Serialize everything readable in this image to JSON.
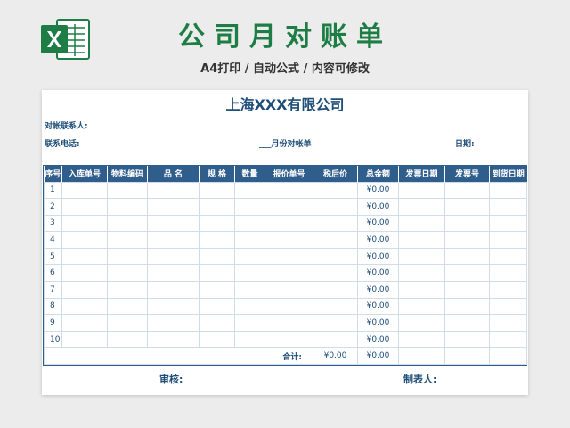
{
  "header": {
    "title": "公司月对账单",
    "subtitle": "A4打印 / 自动公式 / 内容可修改",
    "logo_icon": "excel-logo-icon",
    "accent_color": "#1e7d45"
  },
  "sheet": {
    "company": "上海XXX有限公司",
    "contact_label": "对帐联系人:",
    "phone_label": "联系电话:",
    "month_label": "___月份对帐单",
    "date_label": "日期:",
    "header_color": "#2f5d8c",
    "columns": [
      "序号",
      "入库单号",
      "物料编码",
      "品 名",
      "规 格",
      "数量",
      "报价单号",
      "税后价",
      "总金额",
      "发票日期",
      "发票号",
      "到货日期"
    ],
    "rows": [
      {
        "idx": "1",
        "total": "¥0.00"
      },
      {
        "idx": "2",
        "total": "¥0.00"
      },
      {
        "idx": "3",
        "total": "¥0.00"
      },
      {
        "idx": "4",
        "total": "¥0.00"
      },
      {
        "idx": "5",
        "total": "¥0.00"
      },
      {
        "idx": "6",
        "total": "¥0.00"
      },
      {
        "idx": "7",
        "total": "¥0.00"
      },
      {
        "idx": "8",
        "total": "¥0.00"
      },
      {
        "idx": "9",
        "total": "¥0.00"
      },
      {
        "idx": "10",
        "total": "¥0.00"
      }
    ],
    "sum_label": "合计:",
    "sum_after_tax": "¥0.00",
    "sum_total": "¥0.00",
    "review_label": "审核:",
    "maker_label": "制表人:"
  }
}
